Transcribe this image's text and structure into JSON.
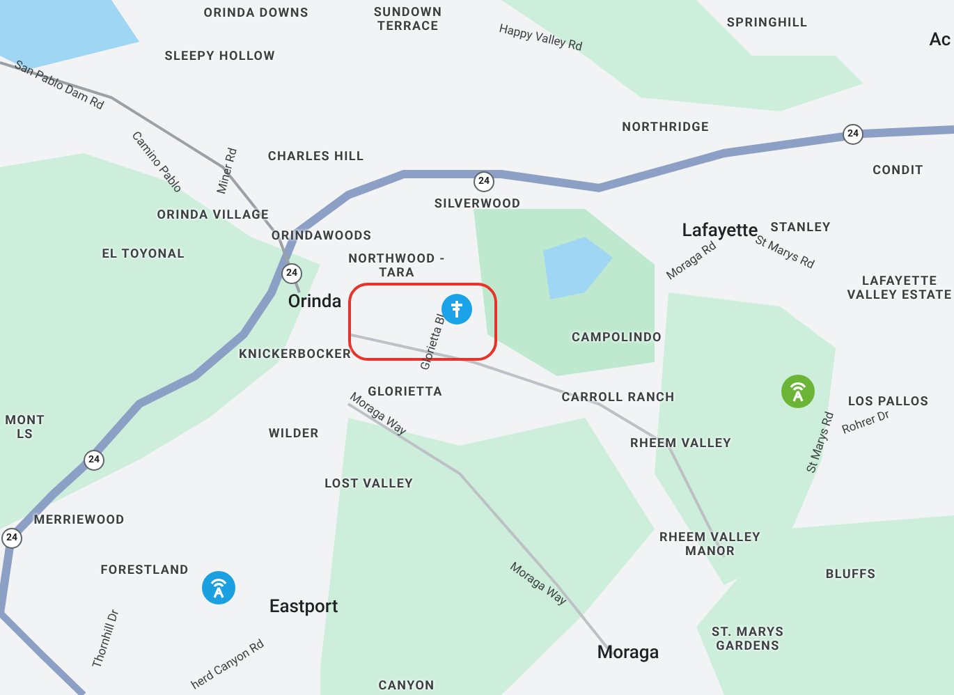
{
  "map": {
    "labels": [
      {
        "text": "ORINDA DOWNS",
        "kind": "area"
      },
      {
        "text": "SUNDOWN TERRACE",
        "kind": "area"
      },
      {
        "text": "SLEEPY HOLLOW",
        "kind": "area"
      },
      {
        "text": "Happy Valley Rd",
        "kind": "road"
      },
      {
        "text": "SPRINGHILL",
        "kind": "area"
      },
      {
        "text": "Ac",
        "kind": "city"
      },
      {
        "text": "San Pablo Dam Rd",
        "kind": "road"
      },
      {
        "text": "Camino Pablo",
        "kind": "road"
      },
      {
        "text": "Miner Rd",
        "kind": "road"
      },
      {
        "text": "CHARLES HILL",
        "kind": "area"
      },
      {
        "text": "NORTHRIDGE",
        "kind": "area"
      },
      {
        "text": "CONDIT",
        "kind": "area"
      },
      {
        "text": "SILVERWOOD",
        "kind": "area"
      },
      {
        "text": "ORINDA VILLAGE",
        "kind": "area"
      },
      {
        "text": "EL TOYONAL",
        "kind": "area"
      },
      {
        "text": "ORINDAWOODS",
        "kind": "area"
      },
      {
        "text": "NORTHWOOD - TARA",
        "kind": "area"
      },
      {
        "text": "Orinda",
        "kind": "city"
      },
      {
        "text": "Lafayette",
        "kind": "city"
      },
      {
        "text": "STANLEY",
        "kind": "area"
      },
      {
        "text": "St Marys Rd",
        "kind": "road"
      },
      {
        "text": "Moraga Rd",
        "kind": "road"
      },
      {
        "text": "LAFAYETTE VALLEY ESTATE",
        "kind": "area"
      },
      {
        "text": "Glorietta Bl",
        "kind": "road"
      },
      {
        "text": "CAMPOLINDO",
        "kind": "area"
      },
      {
        "text": "KNICKERBOCKER",
        "kind": "area"
      },
      {
        "text": "GLORIETTA",
        "kind": "area"
      },
      {
        "text": "Moraga Way",
        "kind": "road"
      },
      {
        "text": "CARROLL RANCH",
        "kind": "area"
      },
      {
        "text": "LOS PALLOS",
        "kind": "area"
      },
      {
        "text": "MONT LS",
        "kind": "area"
      },
      {
        "text": "WILDER",
        "kind": "area"
      },
      {
        "text": "St Marys Rd",
        "kind": "road"
      },
      {
        "text": "Rohrer Dr",
        "kind": "road"
      },
      {
        "text": "RHEEM VALLEY",
        "kind": "area"
      },
      {
        "text": "LOST VALLEY",
        "kind": "area"
      },
      {
        "text": "MERRIEWOOD",
        "kind": "area"
      },
      {
        "text": "RHEEM VALLEY MANOR",
        "kind": "area"
      },
      {
        "text": "FORESTLAND",
        "kind": "area"
      },
      {
        "text": "BLUFFS",
        "kind": "area"
      },
      {
        "text": "Moraga Way",
        "kind": "road"
      },
      {
        "text": "Eastport",
        "kind": "city"
      },
      {
        "text": "Thornhill Dr",
        "kind": "road"
      },
      {
        "text": "ST. MARYS GARDENS",
        "kind": "area"
      },
      {
        "text": "Moraga",
        "kind": "city"
      },
      {
        "text": "herd Canyon Rd",
        "kind": "road"
      },
      {
        "text": "CANYON",
        "kind": "area"
      }
    ],
    "shields": [
      "24",
      "24",
      "24",
      "24",
      "24"
    ],
    "markers": [
      {
        "kind": "trailhead",
        "color": "#1aa3e8"
      },
      {
        "kind": "tower",
        "color": "#1a9fe0"
      },
      {
        "kind": "tower",
        "color": "#6bb536"
      }
    ]
  }
}
